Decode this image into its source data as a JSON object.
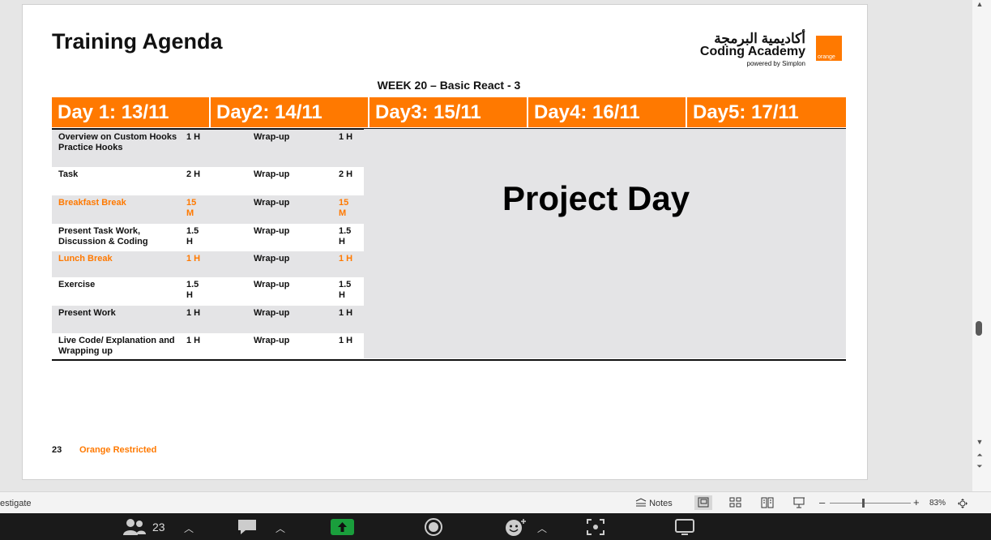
{
  "slide": {
    "title": "Training Agenda",
    "logo": {
      "arabic": "أكاديمية البرمجة",
      "name": "Coding Academy",
      "tagline": "powered by Simplon",
      "brand_box": "orange"
    },
    "week": "WEEK 20 – Basic React  - 3",
    "days": [
      "Day 1: 13/11",
      "Day2: 14/11",
      "Day3: 15/11",
      "Day4: 16/11",
      "Day5: 17/11"
    ],
    "rows": [
      {
        "topic": "Overview on Custom Hooks\nPractice Hooks",
        "dur1": "1 H",
        "day2": "Wrap-up",
        "dur2": "1 H",
        "type": "normal"
      },
      {
        "topic": "Task",
        "dur1": "2 H",
        "day2": "Wrap-up",
        "dur2": "2 H",
        "type": "normal"
      },
      {
        "topic": "Breakfast Break",
        "dur1": "15\nM",
        "day2": "Wrap-up",
        "dur2": "15\nM",
        "type": "break"
      },
      {
        "topic": "Present Task Work, Discussion & Coding",
        "dur1": "1.5\nH",
        "day2": "Wrap-up",
        "dur2": "1.5\nH",
        "type": "normal"
      },
      {
        "topic": "Lunch Break",
        "dur1": "1 H",
        "day2": "Wrap-up",
        "dur2": "1 H",
        "type": "break"
      },
      {
        "topic": "Exercise",
        "dur1": "1.5\nH",
        "day2": "Wrap-up",
        "dur2": "1.5\nH",
        "type": "normal"
      },
      {
        "topic": "Present Work",
        "dur1": "1 H",
        "day2": "Wrap-up",
        "dur2": "1 H",
        "type": "normal"
      },
      {
        "topic": "Live Code/ Explanation and Wrapping up",
        "dur1": "1 H",
        "day2": "Wrap-up",
        "dur2": "1 H",
        "type": "normal"
      }
    ],
    "project_day": "Project Day",
    "page_number": "23",
    "classification": "Orange Restricted"
  },
  "status_bar": {
    "left_text": "estigate",
    "notes_label": "Notes",
    "zoom_minus": "–",
    "zoom_plus": "+",
    "zoom_level": "83%"
  },
  "meeting_toolbar": {
    "participants_count": "23"
  },
  "colors": {
    "accent": "#ff7900",
    "header_text": "#ffffff",
    "row_alt": "#e4e4e6",
    "share_button": "#1a9e3c"
  }
}
